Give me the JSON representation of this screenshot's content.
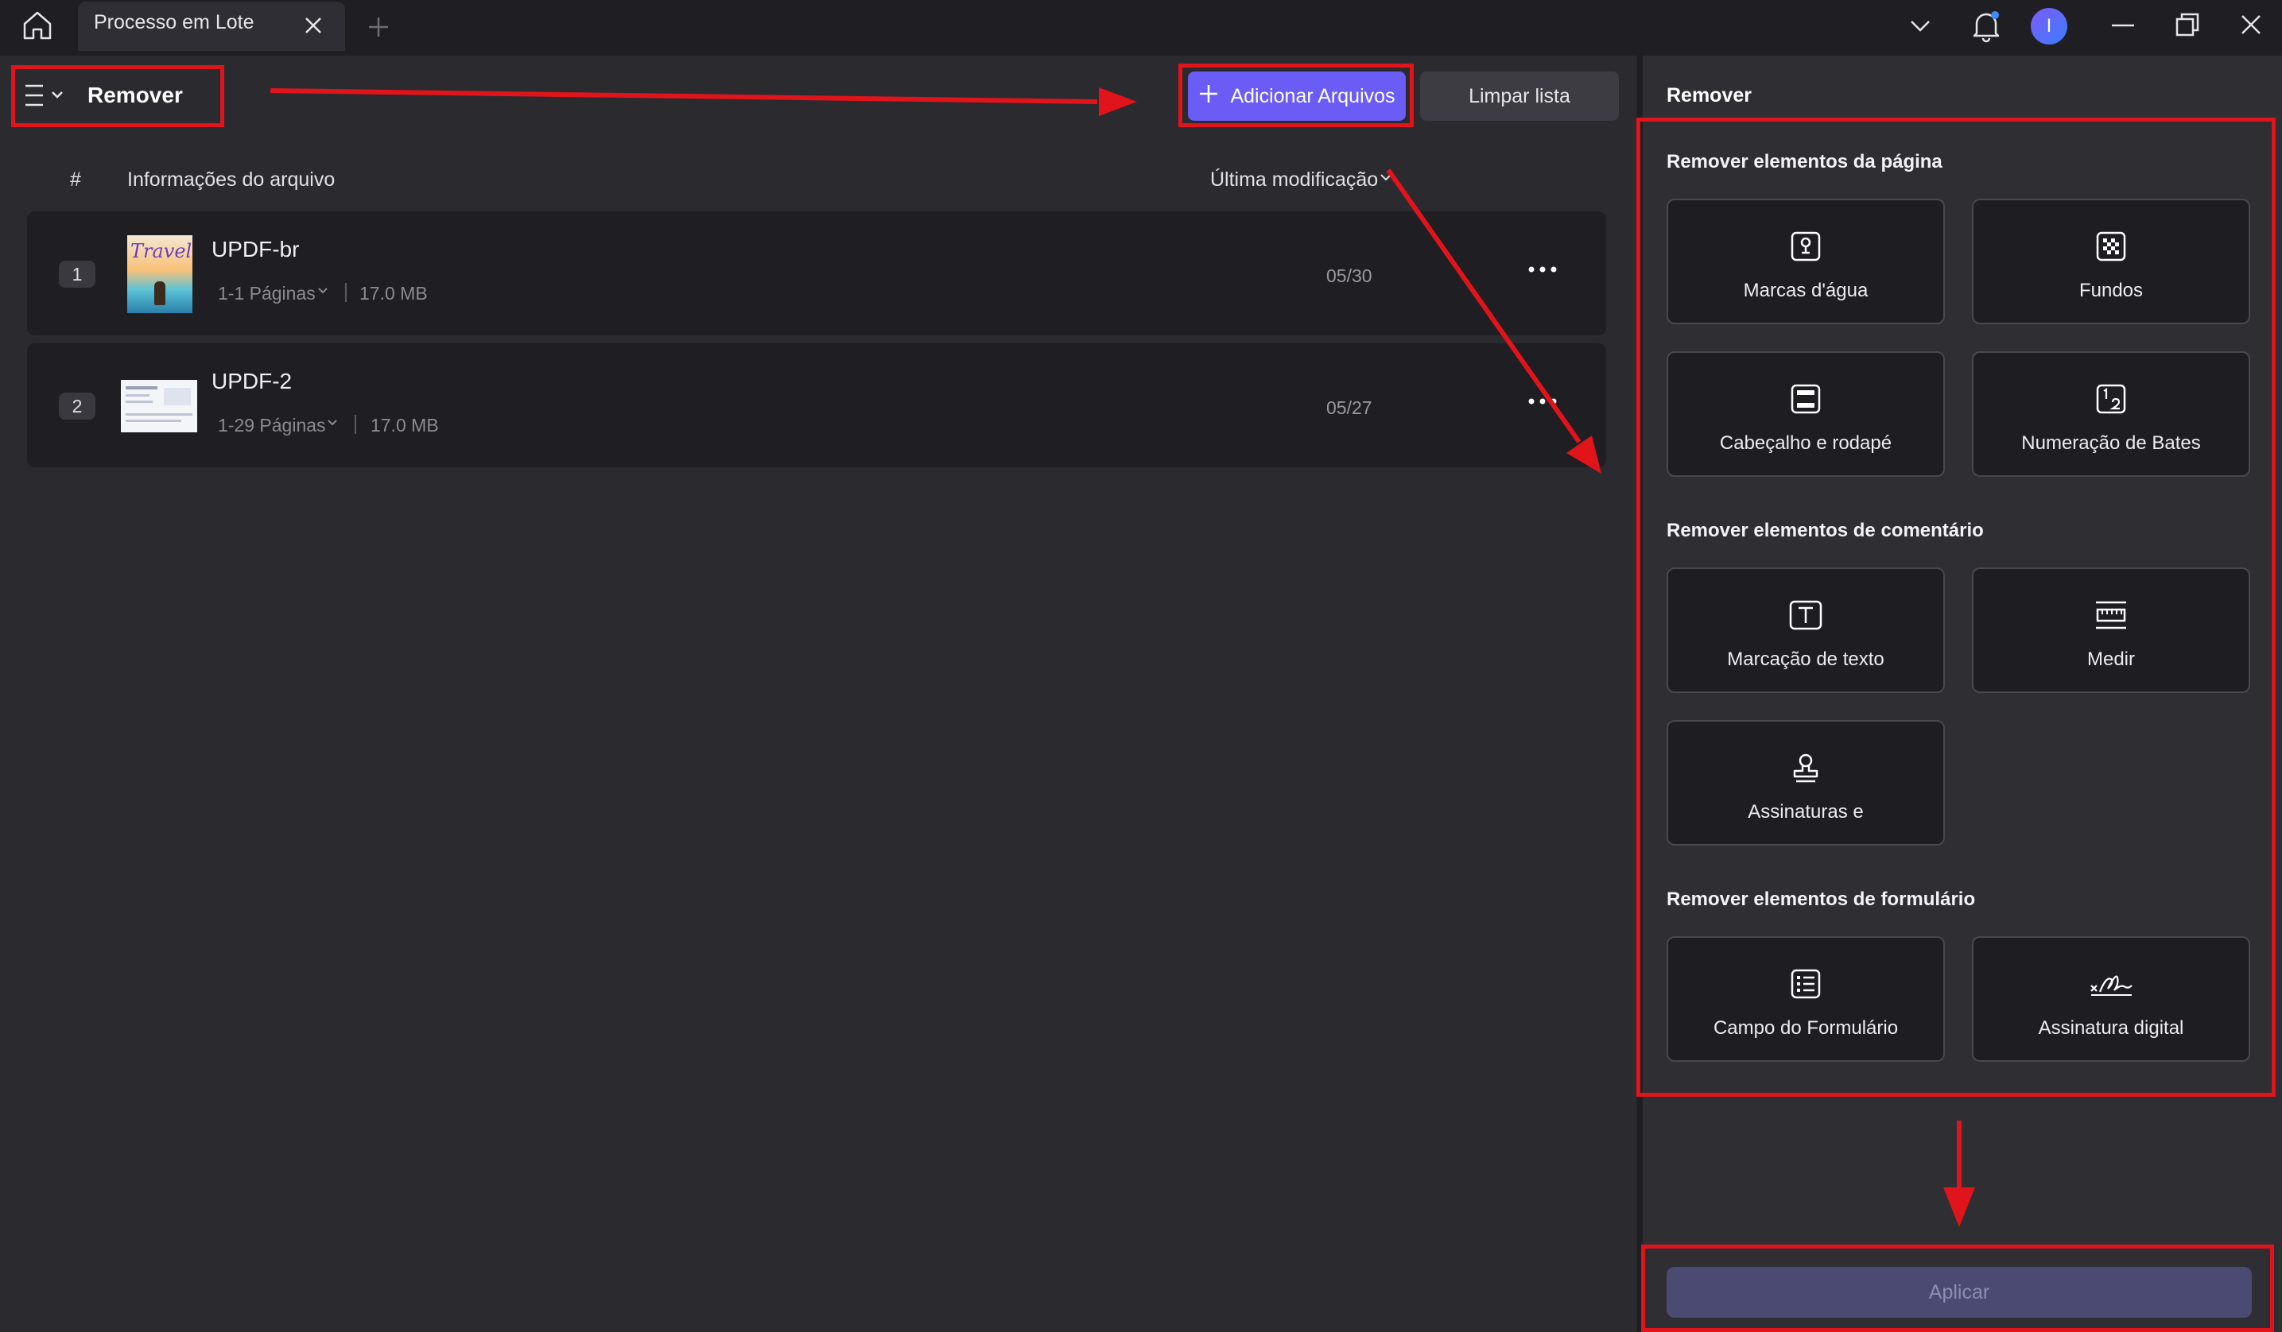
{
  "titlebar": {
    "tab_label": "Processo em Lote",
    "avatar_letter": "I"
  },
  "left": {
    "title": "Remover",
    "add_files_label": "Adicionar Arquivos",
    "clear_list_label": "Limpar lista",
    "columns": {
      "index": "#",
      "file_info": "Informações do arquivo",
      "last_modified": "Última modificação"
    },
    "files": [
      {
        "index": "1",
        "name": "UPDF-br",
        "pages": "1-1 Páginas",
        "size": "17.0 MB",
        "date": "05/30",
        "thumb_text": "Travel"
      },
      {
        "index": "2",
        "name": "UPDF-2",
        "pages": "1-29 Páginas",
        "size": "17.0 MB",
        "date": "05/27"
      }
    ]
  },
  "right": {
    "title": "Remover",
    "sections": [
      {
        "title": "Remover elementos da página",
        "items": [
          "Marcas d'água",
          "Fundos",
          "Cabeçalho e rodapé",
          "Numeração de Bates"
        ]
      },
      {
        "title": "Remover elementos de comentário",
        "items": [
          "Marcação de texto",
          "Medir",
          "Assinaturas e"
        ]
      },
      {
        "title": "Remover elementos de formulário",
        "items": [
          "Campo do Formulário",
          "Assinatura digital"
        ]
      }
    ],
    "apply_label": "Aplicar"
  },
  "colors": {
    "accent": "#6b5cf6",
    "annotation_red": "#e0141a",
    "background": "#2b2a2f"
  }
}
